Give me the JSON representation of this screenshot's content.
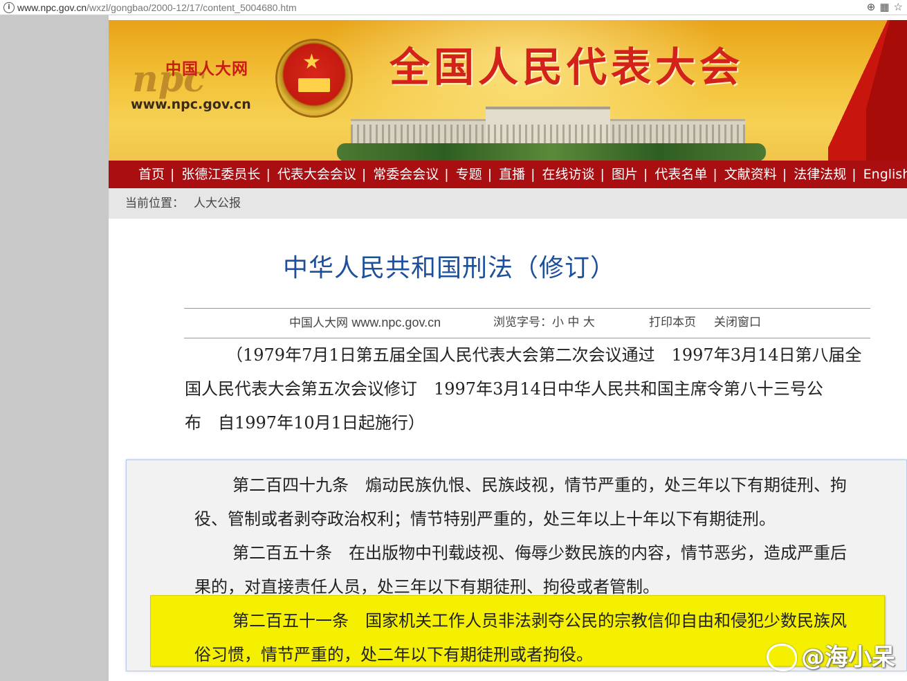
{
  "browser": {
    "url_host": "www.npc.gov.cn",
    "url_path": "/wxzl/gongbao/2000-12/17/content_5004680.htm",
    "info_icon": "info-icon",
    "tool_icons": [
      "zoom-icon",
      "qr-code-icon",
      "bookmark-star-icon"
    ]
  },
  "header": {
    "logo_cn": "中国人大网",
    "logo_mark": "npc",
    "logo_url": "www.npc.gov.cn",
    "site_title": "全国人民代表大会"
  },
  "nav": {
    "items": [
      "首页",
      "张德江委员长",
      "代表大会会议",
      "常委会会议",
      "专题",
      "直播",
      "在线访谈",
      "图片",
      "代表名单",
      "文献资料",
      "法律法规",
      "English"
    ],
    "separator": "|"
  },
  "breadcrumb": {
    "label": "当前位置：",
    "current": "人大公报"
  },
  "article": {
    "title": "中华人民共和国刑法（修订）",
    "source_cn": "中国人大网",
    "source_url": "www.npc.gov.cn",
    "font_size_label": "浏览字号：",
    "font_sizes": [
      "小",
      "中",
      "大"
    ],
    "print": "打印本页",
    "close": "关闭窗口",
    "intro_lines": [
      "（1979年7月1日第五届全国人民代表大会第二次会议通过　1997年3月14日第八届全",
      "国人民代表大会第五次会议修订　1997年3月14日中华人民共和国主席令第八十三号公",
      "布　自1997年10月1日起施行）"
    ]
  },
  "quote": {
    "lines": [
      "第二百四十九条　煽动民族仇恨、民族歧视，情节严重的，处三年以下有期徒刑、拘",
      "役、管制或者剥夺政治权利；情节特别严重的，处三年以上十年以下有期徒刑。",
      "第二百五十条　在出版物中刊载歧视、侮辱少数民族的内容，情节恶劣，造成严重后",
      "果的，对直接责任人员，处三年以下有期徒刑、拘役或者管制。",
      "第二百五十一条　国家机关工作人员非法剥夺公民的宗教信仰自由和侵犯少数民族风",
      "俗习惯，情节严重的，处二年以下有期徒刑或者拘役。"
    ],
    "highlight_color": "#f4f000"
  },
  "watermark": {
    "text": "@海小呆",
    "icon": "weibo-icon"
  },
  "colors": {
    "nav_bg": "#a90e10",
    "title_blue": "#1c4f9c",
    "banner_title_red": "#d2221a"
  }
}
